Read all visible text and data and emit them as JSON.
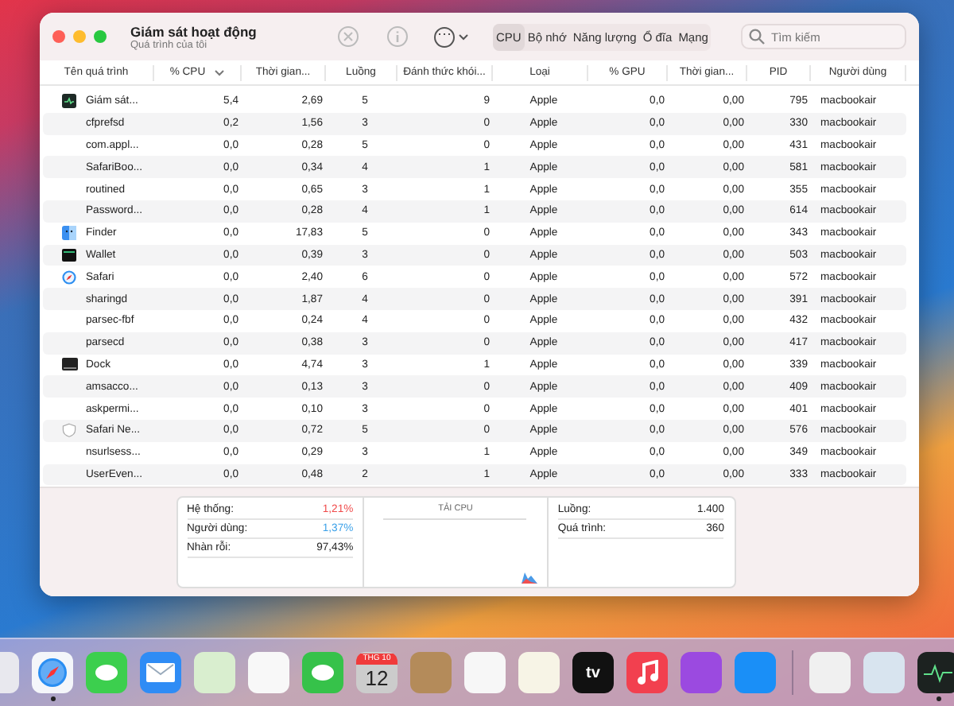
{
  "window": {
    "title": "Giám sát hoạt động",
    "subtitle": "Quá trình của tôi"
  },
  "toolbar": {
    "more_label": "⋯",
    "tabs": [
      {
        "label": "CPU",
        "selected": true
      },
      {
        "label": "Bộ nhớ",
        "selected": false
      },
      {
        "label": "Năng lượng",
        "selected": false
      },
      {
        "label": "Ổ đĩa",
        "selected": false
      },
      {
        "label": "Mạng",
        "selected": false
      }
    ],
    "search": {
      "placeholder": "Tìm kiếm"
    }
  },
  "table": {
    "columns": [
      {
        "label": "Tên quá trình",
        "sorted": false
      },
      {
        "label": "% CPU",
        "sorted": true
      },
      {
        "label": "Thời gian...",
        "sorted": false
      },
      {
        "label": "Luồng",
        "sorted": false
      },
      {
        "label": "Đánh thức khói...",
        "sorted": false
      },
      {
        "label": "Loại",
        "sorted": false
      },
      {
        "label": "% GPU",
        "sorted": false
      },
      {
        "label": "Thời gian...",
        "sorted": false
      },
      {
        "label": "PID",
        "sorted": false
      },
      {
        "label": "Người dùng",
        "sorted": false
      }
    ],
    "rows": [
      {
        "kind": "monitor",
        "cells": [
          "Giám sát...",
          "5,4",
          "2,69",
          "5",
          "9",
          "Apple",
          "0,0",
          "0,00",
          "795",
          "macbookair"
        ]
      },
      {
        "kind": "none",
        "cells": [
          "cfprefsd",
          "0,2",
          "1,56",
          "3",
          "0",
          "Apple",
          "0,0",
          "0,00",
          "330",
          "macbookair"
        ]
      },
      {
        "kind": "none",
        "cells": [
          "com.appl...",
          "0,0",
          "0,28",
          "5",
          "0",
          "Apple",
          "0,0",
          "0,00",
          "431",
          "macbookair"
        ]
      },
      {
        "kind": "none",
        "cells": [
          "SafariBoo...",
          "0,0",
          "0,34",
          "4",
          "1",
          "Apple",
          "0,0",
          "0,00",
          "581",
          "macbookair"
        ]
      },
      {
        "kind": "none",
        "cells": [
          "routined",
          "0,0",
          "0,65",
          "3",
          "1",
          "Apple",
          "0,0",
          "0,00",
          "355",
          "macbookair"
        ]
      },
      {
        "kind": "none",
        "cells": [
          "Password...",
          "0,0",
          "0,28",
          "4",
          "1",
          "Apple",
          "0,0",
          "0,00",
          "614",
          "macbookair"
        ]
      },
      {
        "kind": "finder",
        "cells": [
          "Finder",
          "0,0",
          "17,83",
          "5",
          "0",
          "Apple",
          "0,0",
          "0,00",
          "343",
          "macbookair"
        ]
      },
      {
        "kind": "wallet",
        "cells": [
          "Wallet",
          "0,0",
          "0,39",
          "3",
          "0",
          "Apple",
          "0,0",
          "0,00",
          "503",
          "macbookair"
        ]
      },
      {
        "kind": "compass",
        "cells": [
          "Safari",
          "0,0",
          "2,40",
          "6",
          "0",
          "Apple",
          "0,0",
          "0,00",
          "572",
          "macbookair"
        ]
      },
      {
        "kind": "none",
        "cells": [
          "sharingd",
          "0,0",
          "1,87",
          "4",
          "0",
          "Apple",
          "0,0",
          "0,00",
          "391",
          "macbookair"
        ]
      },
      {
        "kind": "none",
        "cells": [
          "parsec-fbf",
          "0,0",
          "0,24",
          "4",
          "0",
          "Apple",
          "0,0",
          "0,00",
          "432",
          "macbookair"
        ]
      },
      {
        "kind": "none",
        "cells": [
          "parsecd",
          "0,0",
          "0,38",
          "3",
          "0",
          "Apple",
          "0,0",
          "0,00",
          "417",
          "macbookair"
        ]
      },
      {
        "kind": "screen",
        "cells": [
          "Dock",
          "0,0",
          "4,74",
          "3",
          "1",
          "Apple",
          "0,0",
          "0,00",
          "339",
          "macbookair"
        ]
      },
      {
        "kind": "none",
        "cells": [
          "amsacco...",
          "0,0",
          "0,13",
          "3",
          "0",
          "Apple",
          "0,0",
          "0,00",
          "409",
          "macbookair"
        ]
      },
      {
        "kind": "none",
        "cells": [
          "askpermi...",
          "0,0",
          "0,10",
          "3",
          "0",
          "Apple",
          "0,0",
          "0,00",
          "401",
          "macbookair"
        ]
      },
      {
        "kind": "shield",
        "cells": [
          "Safari Ne...",
          "0,0",
          "0,72",
          "5",
          "0",
          "Apple",
          "0,0",
          "0,00",
          "576",
          "macbookair"
        ]
      },
      {
        "kind": "none",
        "cells": [
          "nsurlsess...",
          "0,0",
          "0,29",
          "3",
          "1",
          "Apple",
          "0,0",
          "0,00",
          "349",
          "macbookair"
        ]
      },
      {
        "kind": "none",
        "cells": [
          "UserEven...",
          "0,0",
          "0,48",
          "2",
          "1",
          "Apple",
          "0,0",
          "0,00",
          "333",
          "macbookair"
        ]
      }
    ]
  },
  "summary": {
    "left": [
      {
        "label": "Hệ thống:",
        "value": "1,21%",
        "color": "#f04a4a"
      },
      {
        "label": "Người dùng:",
        "value": "1,37%",
        "color": "#3aa0e8"
      },
      {
        "label": "Nhàn rỗi:",
        "value": "97,43%",
        "color": "#222222"
      }
    ],
    "chart_title": "TẢI CPU",
    "right": [
      {
        "label": "Luồng:",
        "value": "1.400"
      },
      {
        "label": "Quá trình:",
        "value": "360"
      }
    ]
  },
  "dock": {
    "items": [
      {
        "kind": "launchpad",
        "running": false
      },
      {
        "kind": "safari",
        "running": true
      },
      {
        "kind": "messages",
        "running": false
      },
      {
        "kind": "mail",
        "running": false
      },
      {
        "kind": "maps",
        "running": false
      },
      {
        "kind": "photos",
        "running": false
      },
      {
        "kind": "facetime",
        "running": false
      },
      {
        "kind": "calendar",
        "running": false,
        "month": "THG 10",
        "day": "12"
      },
      {
        "kind": "contacts",
        "running": false
      },
      {
        "kind": "reminders",
        "running": false
      },
      {
        "kind": "notes",
        "running": false
      },
      {
        "kind": "tv",
        "running": false,
        "text": "tv"
      },
      {
        "kind": "music",
        "running": false
      },
      {
        "kind": "podcasts",
        "running": false
      },
      {
        "kind": "appstore",
        "running": false
      },
      {
        "kind": "divider"
      },
      {
        "kind": "utility",
        "running": false
      },
      {
        "kind": "preview",
        "running": false
      },
      {
        "kind": "monitor",
        "running": true
      }
    ]
  }
}
